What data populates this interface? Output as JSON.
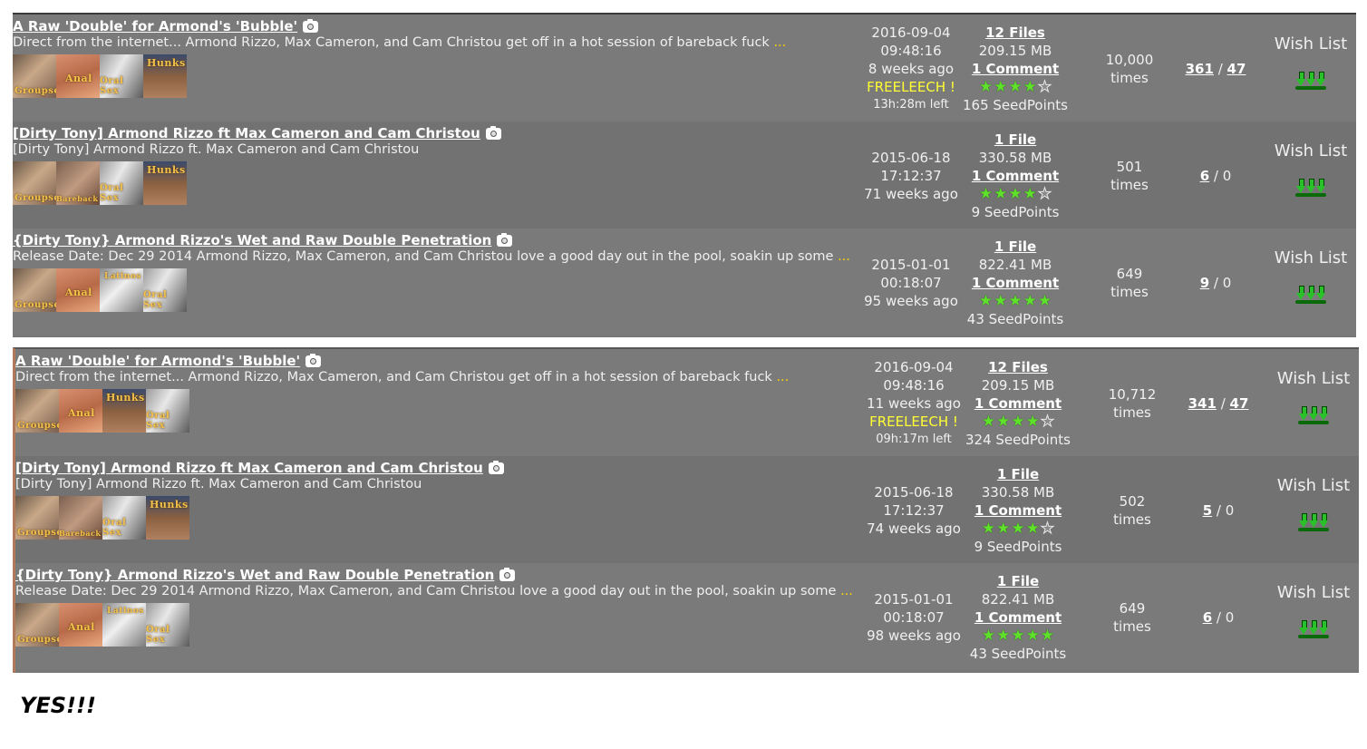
{
  "colors": {
    "row_background": "#777777",
    "freeleech_text": "#ffff33",
    "star_color": "#5fe02a",
    "download_arrow": "#2ac02a"
  },
  "blocks": [
    {
      "rows": [
        {
          "title": "A Raw 'Double' for Armond's 'Bubble'",
          "description": "Direct from the internet... Armond Rizzo, Max Cameron, and Cam Christou get off in a hot session of bareback fuck",
          "ellipsis": "...",
          "tags": [
            {
              "icon": "groupsex-tag-icon",
              "label": "Groupsex",
              "style": "t-groupsex"
            },
            {
              "icon": "anal-tag-icon",
              "label": "Anal",
              "style": "t-anal"
            },
            {
              "icon": "oral-sex-tag-icon",
              "label": "Oral Sex",
              "style": "t-oral"
            },
            {
              "icon": "hunks-tag-icon",
              "label": "Hunks",
              "style": "t-hunks"
            }
          ],
          "date": "2016-09-04",
          "time": "09:48:16",
          "age": "8 weeks ago",
          "freeleech": "FREELEECH !",
          "time_left": "13h:28m left",
          "files": "12 Files",
          "size": "209.15 MB",
          "comments": "1 Comment",
          "rating": 4.5,
          "seedpoints": "165 SeedPoints",
          "snatched": "10,000",
          "snatched_unit": "times",
          "seeders": "361",
          "separator": "/",
          "leechers": "47",
          "wishlist": "Wish List"
        },
        {
          "title": "[Dirty Tony] Armond Rizzo ft Max Cameron and Cam Christou",
          "description": "[Dirty Tony] Armond Rizzo ft. Max Cameron and Cam Christou",
          "ellipsis": "",
          "tags": [
            {
              "icon": "groupsex-tag-icon",
              "label": "Groupsex",
              "style": "t-groupsex"
            },
            {
              "icon": "bareback-tag-icon",
              "label": "Bareback",
              "style": "t-bareback"
            },
            {
              "icon": "oral-sex-tag-icon",
              "label": "Oral Sex",
              "style": "t-oral"
            },
            {
              "icon": "hunks-tag-icon",
              "label": "Hunks",
              "style": "t-hunks"
            }
          ],
          "date": "2015-06-18",
          "time": "17:12:37",
          "age": "71 weeks ago",
          "freeleech": "",
          "time_left": "",
          "files": "1 File",
          "size": "330.58 MB",
          "comments": "1 Comment",
          "rating": 4,
          "seedpoints": "9 SeedPoints",
          "snatched": "501",
          "snatched_unit": "times",
          "seeders": "6",
          "separator": "/",
          "leechers": "0",
          "wishlist": "Wish List"
        },
        {
          "title": "{Dirty Tony} Armond Rizzo's Wet and Raw Double Penetration",
          "description": "Release Date: Dec 29 2014 Armond Rizzo, Max Cameron, and Cam Christou love a good day out in the pool, soakin up some",
          "ellipsis": "...",
          "tags": [
            {
              "icon": "groupsex-tag-icon",
              "label": "Groupsex",
              "style": "t-groupsex"
            },
            {
              "icon": "anal-tag-icon",
              "label": "Anal",
              "style": "t-anal"
            },
            {
              "icon": "latinos-tag-icon",
              "label": "Latinos",
              "style": "t-latinos"
            },
            {
              "icon": "oral-sex-tag-icon",
              "label": "Oral Sex",
              "style": "t-oral"
            }
          ],
          "date": "2015-01-01",
          "time": "00:18:07",
          "age": "95 weeks ago",
          "freeleech": "",
          "time_left": "",
          "files": "1 File",
          "size": "822.41 MB",
          "comments": "1 Comment",
          "rating": 5,
          "seedpoints": "43 SeedPoints",
          "snatched": "649",
          "snatched_unit": "times",
          "seeders": "9",
          "separator": "/",
          "leechers": "0",
          "wishlist": "Wish List"
        }
      ]
    },
    {
      "rows": [
        {
          "title": "A Raw 'Double' for Armond's 'Bubble'",
          "description": "Direct from the internet... Armond Rizzo, Max Cameron, and Cam Christou get off in a hot session of bareback fuck",
          "ellipsis": "...",
          "tags": [
            {
              "icon": "groupsex-tag-icon",
              "label": "Groupsex",
              "style": "t-groupsex"
            },
            {
              "icon": "anal-tag-icon",
              "label": "Anal",
              "style": "t-anal"
            },
            {
              "icon": "hunks-tag-icon",
              "label": "Hunks",
              "style": "t-hunks"
            },
            {
              "icon": "oral-sex-tag-icon",
              "label": "Oral Sex",
              "style": "t-oral"
            }
          ],
          "date": "2016-09-04",
          "time": "09:48:16",
          "age": "11 weeks ago",
          "freeleech": "FREELEECH !",
          "time_left": "09h:17m left",
          "files": "12 Files",
          "size": "209.15 MB",
          "comments": "1 Comment",
          "rating": 4.5,
          "seedpoints": "324 SeedPoints",
          "snatched": "10,712",
          "snatched_unit": "times",
          "seeders": "341",
          "separator": "/",
          "leechers": "47",
          "wishlist": "Wish List"
        },
        {
          "title": "[Dirty Tony] Armond Rizzo ft Max Cameron and Cam Christou",
          "description": "[Dirty Tony] Armond Rizzo ft. Max Cameron and Cam Christou",
          "ellipsis": "",
          "tags": [
            {
              "icon": "groupsex-tag-icon",
              "label": "Groupsex",
              "style": "t-groupsex"
            },
            {
              "icon": "bareback-tag-icon",
              "label": "Bareback",
              "style": "t-bareback"
            },
            {
              "icon": "oral-sex-tag-icon",
              "label": "Oral Sex",
              "style": "t-oral"
            },
            {
              "icon": "hunks-tag-icon",
              "label": "Hunks",
              "style": "t-hunks"
            }
          ],
          "date": "2015-06-18",
          "time": "17:12:37",
          "age": "74 weeks ago",
          "freeleech": "",
          "time_left": "",
          "files": "1 File",
          "size": "330.58 MB",
          "comments": "1 Comment",
          "rating": 4,
          "seedpoints": "9 SeedPoints",
          "snatched": "502",
          "snatched_unit": "times",
          "seeders": "5",
          "separator": "/",
          "leechers": "0",
          "wishlist": "Wish List"
        },
        {
          "title": "{Dirty Tony} Armond Rizzo's Wet and Raw Double Penetration",
          "description": "Release Date: Dec 29 2014 Armond Rizzo, Max Cameron, and Cam Christou love a good day out in the pool, soakin up some",
          "ellipsis": "...",
          "tags": [
            {
              "icon": "groupsex-tag-icon",
              "label": "Groupsex",
              "style": "t-groupsex"
            },
            {
              "icon": "anal-tag-icon",
              "label": "Anal",
              "style": "t-anal"
            },
            {
              "icon": "latinos-tag-icon",
              "label": "Latinos",
              "style": "t-latinos"
            },
            {
              "icon": "oral-sex-tag-icon",
              "label": "Oral Sex",
              "style": "t-oral"
            }
          ],
          "date": "2015-01-01",
          "time": "00:18:07",
          "age": "98 weeks ago",
          "freeleech": "",
          "time_left": "",
          "files": "1 File",
          "size": "822.41 MB",
          "comments": "1 Comment",
          "rating": 5,
          "seedpoints": "43 SeedPoints",
          "snatched": "649",
          "snatched_unit": "times",
          "seeders": "6",
          "separator": "/",
          "leechers": "0",
          "wishlist": "Wish List"
        }
      ]
    }
  ],
  "caption": "YES!!!"
}
